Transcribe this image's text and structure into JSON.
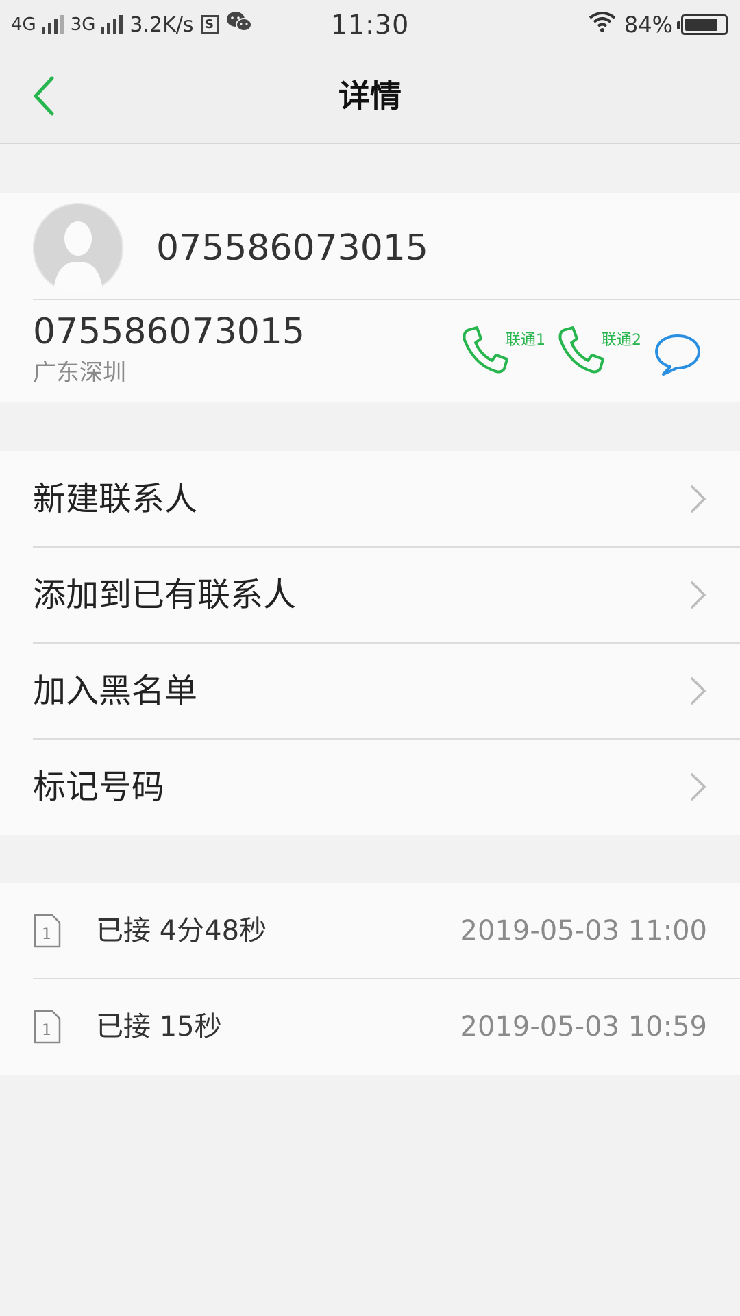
{
  "status_bar": {
    "net1": "4G",
    "net2": "3G",
    "speed": "3.2K/s",
    "time": "11:30",
    "battery": "84%",
    "battery_level": 0.84,
    "icons": [
      "signal-icon",
      "sim-s-icon",
      "wechat-icon",
      "wifi-icon",
      "battery-icon"
    ]
  },
  "titlebar": {
    "title": "详情",
    "back_icon": "chevron-left-icon"
  },
  "contact": {
    "header_number": "075586073015",
    "number": "075586073015",
    "location": "广东深圳",
    "call1_label": "联通1",
    "call2_label": "联通2",
    "accent": "#27b54d",
    "message_color": "#2a8fe0"
  },
  "menu": {
    "items": [
      {
        "label": "新建联系人"
      },
      {
        "label": "添加到已有联系人"
      },
      {
        "label": "加入黑名单"
      },
      {
        "label": "标记号码"
      }
    ]
  },
  "call_log": {
    "items": [
      {
        "sim": "1",
        "status": "已接 4分48秒",
        "time": "2019-05-03 11:00"
      },
      {
        "sim": "1",
        "status": "已接 15秒",
        "time": "2019-05-03 10:59"
      }
    ]
  }
}
